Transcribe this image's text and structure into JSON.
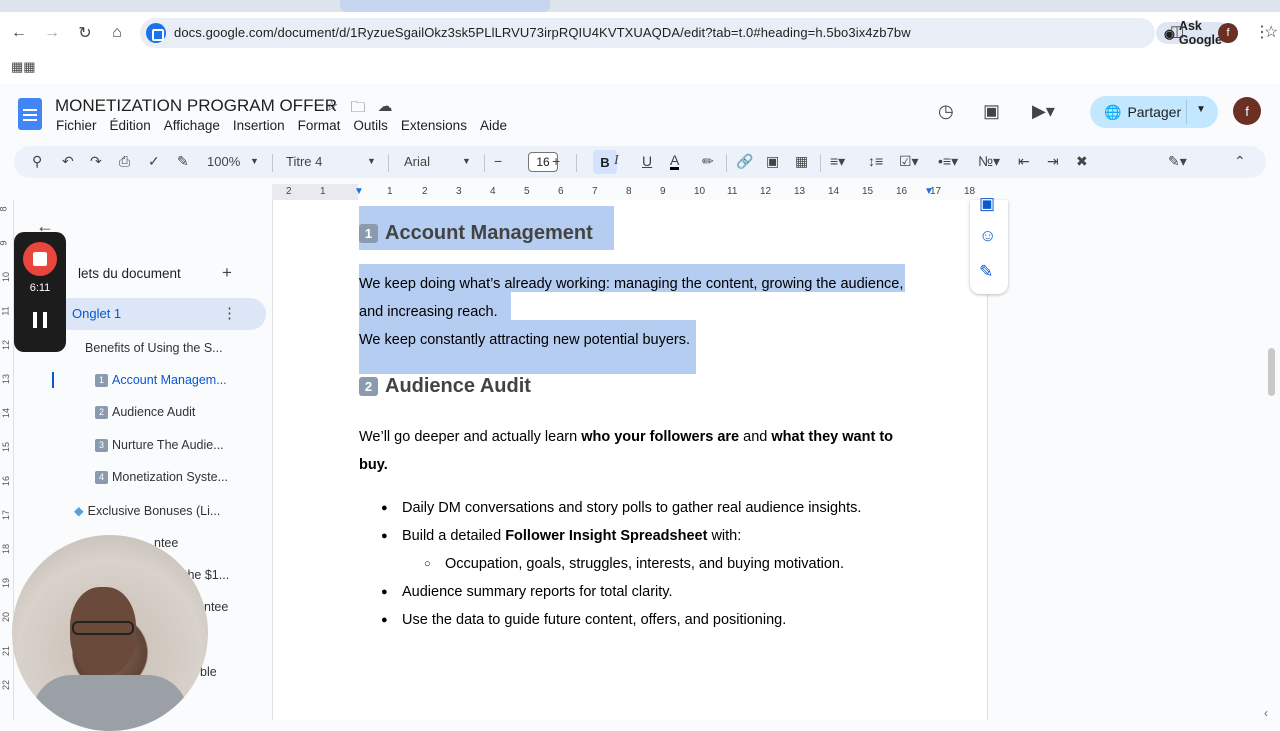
{
  "browser": {
    "url": "docs.google.com/document/d/1RyzueSgailOkz3sk5PLlLRVU73irpRQIU4KVTXUAQDA/edit?tab=t.0#heading=h.5bo3ix4zb7bw",
    "ask_google": "Ask Google",
    "profile_initial": "f"
  },
  "doc": {
    "title": "MONETIZATION PROGRAM OFFER",
    "menus": [
      "Fichier",
      "Édition",
      "Affichage",
      "Insertion",
      "Format",
      "Outils",
      "Extensions",
      "Aide"
    ],
    "share_label": "Partager",
    "avatar_initial": "f"
  },
  "toolbar": {
    "zoom": "100%",
    "style": "Titre 4",
    "font": "Arial",
    "font_size": "16",
    "bold": "B",
    "italic": "I",
    "underline": "U",
    "text_color": "A"
  },
  "ruler": {
    "ticks": [
      "2",
      "1",
      "1",
      "2",
      "3",
      "4",
      "5",
      "6",
      "7",
      "8",
      "9",
      "10",
      "11",
      "12",
      "13",
      "14",
      "15",
      "16",
      "17",
      "18"
    ]
  },
  "vruler": {
    "ticks": [
      "8",
      "9",
      "10",
      "11",
      "12",
      "13",
      "14",
      "15",
      "16",
      "17",
      "18",
      "19",
      "20",
      "21",
      "22"
    ]
  },
  "sidebar": {
    "heading": "lets du document",
    "tab_label": "Onglet 1",
    "items": [
      {
        "label": "Benefits of Using the S...",
        "num": ""
      },
      {
        "label": "Account Managem...",
        "num": "1"
      },
      {
        "label": "Audience Audit",
        "num": "2"
      },
      {
        "label": "Nurture The Audie...",
        "num": "3"
      },
      {
        "label": "Monetization Syste...",
        "num": "4"
      },
      {
        "label": "Exclusive Bonuses (Li...",
        "num": ""
      }
    ],
    "partial": [
      "ntee",
      "the $1...",
      "ntee",
      "ble"
    ]
  },
  "recorder": {
    "time": "6:11"
  },
  "content": {
    "h1_num": "1",
    "h1": "Account Management",
    "p1_line1": "We keep doing what’s already working: managing the content, growing the audience,",
    "p1_line2": "and increasing reach.",
    "p2": "We keep constantly attracting new potential buyers.",
    "h2_num": "2",
    "h2": "Audience Audit",
    "p3_a": "We’ll go deeper and actually learn ",
    "p3_b": "who your followers are",
    "p3_c": " and ",
    "p3_d": "what they want to",
    "p3_e": "buy.",
    "bullets": [
      "Daily DM conversations and story polls to gather real audience insights.",
      "Audience summary reports for total clarity.",
      "Use the data to guide future content, offers, and positioning."
    ],
    "b2_a": "Build a detailed ",
    "b2_b": "Follower Insight Spreadsheet",
    "b2_c": " with:",
    "sub_bullet": "Occupation, goals, struggles, interests, and buying motivation."
  }
}
